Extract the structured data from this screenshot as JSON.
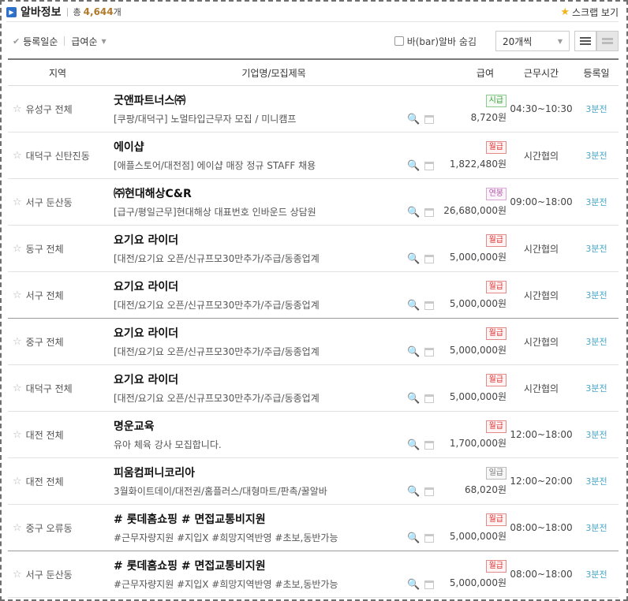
{
  "header": {
    "title": "알바정보",
    "total_label": "총",
    "total_count": "4,644",
    "total_unit": "개",
    "scrap_label": "스크랩 보기"
  },
  "sort": {
    "by_date": "등록일순",
    "by_pay": "급여순",
    "bar_toggle": "바(bar)알바 숨김",
    "per_page": "20개씩"
  },
  "columns": {
    "region": "지역",
    "company": "기업명/모집제목",
    "pay": "급여",
    "time": "근무시간",
    "date": "등록일"
  },
  "rows": [
    {
      "region": "유성구 전체",
      "company": "굿앤파트너스㈜",
      "title": "[쿠팡/대덕구] 노멀타입근무자 모집 / 미니캠프",
      "pay_type": "시급",
      "pay_color": "green",
      "amount": "8,720원",
      "time": "04:30~10:30",
      "date": "3분전",
      "strong": false
    },
    {
      "region": "대덕구 신탄진동",
      "company": "에이샵",
      "title": "[애플스토어/대전점] 에이샵 매장 정규 STAFF 채용",
      "pay_type": "월급",
      "pay_color": "red",
      "amount": "1,822,480원",
      "time": "시간협의",
      "date": "3분전",
      "strong": false
    },
    {
      "region": "서구 둔산동",
      "company": "㈜현대해상C&R",
      "title": "[급구/평일근무]현대해상 대표번호 인바운드 상담원",
      "pay_type": "연봉",
      "pay_color": "purple",
      "amount": "26,680,000원",
      "time": "09:00~18:00",
      "date": "3분전",
      "strong": false
    },
    {
      "region": "동구 전체",
      "company": "요기요 라이더",
      "title": "[대전/요기요 오픈/신규프모30만추가/주급/동종업계",
      "pay_type": "월급",
      "pay_color": "red",
      "amount": "5,000,000원",
      "time": "시간협의",
      "date": "3분전",
      "strong": false
    },
    {
      "region": "서구 전체",
      "company": "요기요 라이더",
      "title": "[대전/요기요 오픈/신규프모30만추가/주급/동종업계",
      "pay_type": "월급",
      "pay_color": "red",
      "amount": "5,000,000원",
      "time": "시간협의",
      "date": "3분전",
      "strong": true
    },
    {
      "region": "중구 전체",
      "company": "요기요 라이더",
      "title": "[대전/요기요 오픈/신규프모30만추가/주급/동종업계",
      "pay_type": "월급",
      "pay_color": "red",
      "amount": "5,000,000원",
      "time": "시간협의",
      "date": "3분전",
      "strong": false
    },
    {
      "region": "대덕구 전체",
      "company": "요기요 라이더",
      "title": "[대전/요기요 오픈/신규프모30만추가/주급/동종업계",
      "pay_type": "월급",
      "pay_color": "red",
      "amount": "5,000,000원",
      "time": "시간협의",
      "date": "3분전",
      "strong": false
    },
    {
      "region": "대전 전체",
      "company": "명운교육",
      "title": "유아 체육 강사 모집합니다.",
      "pay_type": "월급",
      "pay_color": "red",
      "amount": "1,700,000원",
      "time": "12:00~18:00",
      "date": "3분전",
      "strong": false
    },
    {
      "region": "대전 전체",
      "company": "피움컴퍼니코리아",
      "title": "3월화이트데이/대전권/홈플러스/대형마트/판촉/꿀알바",
      "pay_type": "일급",
      "pay_color": "gray",
      "amount": "68,020원",
      "time": "12:00~20:00",
      "date": "3분전",
      "strong": false
    },
    {
      "region": "중구 오류동",
      "company": "# 롯데홈쇼핑 # 면접교통비지원",
      "title": "#근무자량지원 #지입X #희망지역반영 #초보,동반가능",
      "pay_type": "월급",
      "pay_color": "red",
      "amount": "5,000,000원",
      "time": "08:00~18:00",
      "date": "3분전",
      "strong": true
    },
    {
      "region": "서구 둔산동",
      "company": "# 롯데홈쇼핑 # 면접교통비지원",
      "title": "#근무자량지원 #지입X #희망지역반영 #초보,동반가능",
      "pay_type": "월급",
      "pay_color": "red",
      "amount": "5,000,000원",
      "time": "08:00~18:00",
      "date": "3분전",
      "strong": false
    }
  ]
}
